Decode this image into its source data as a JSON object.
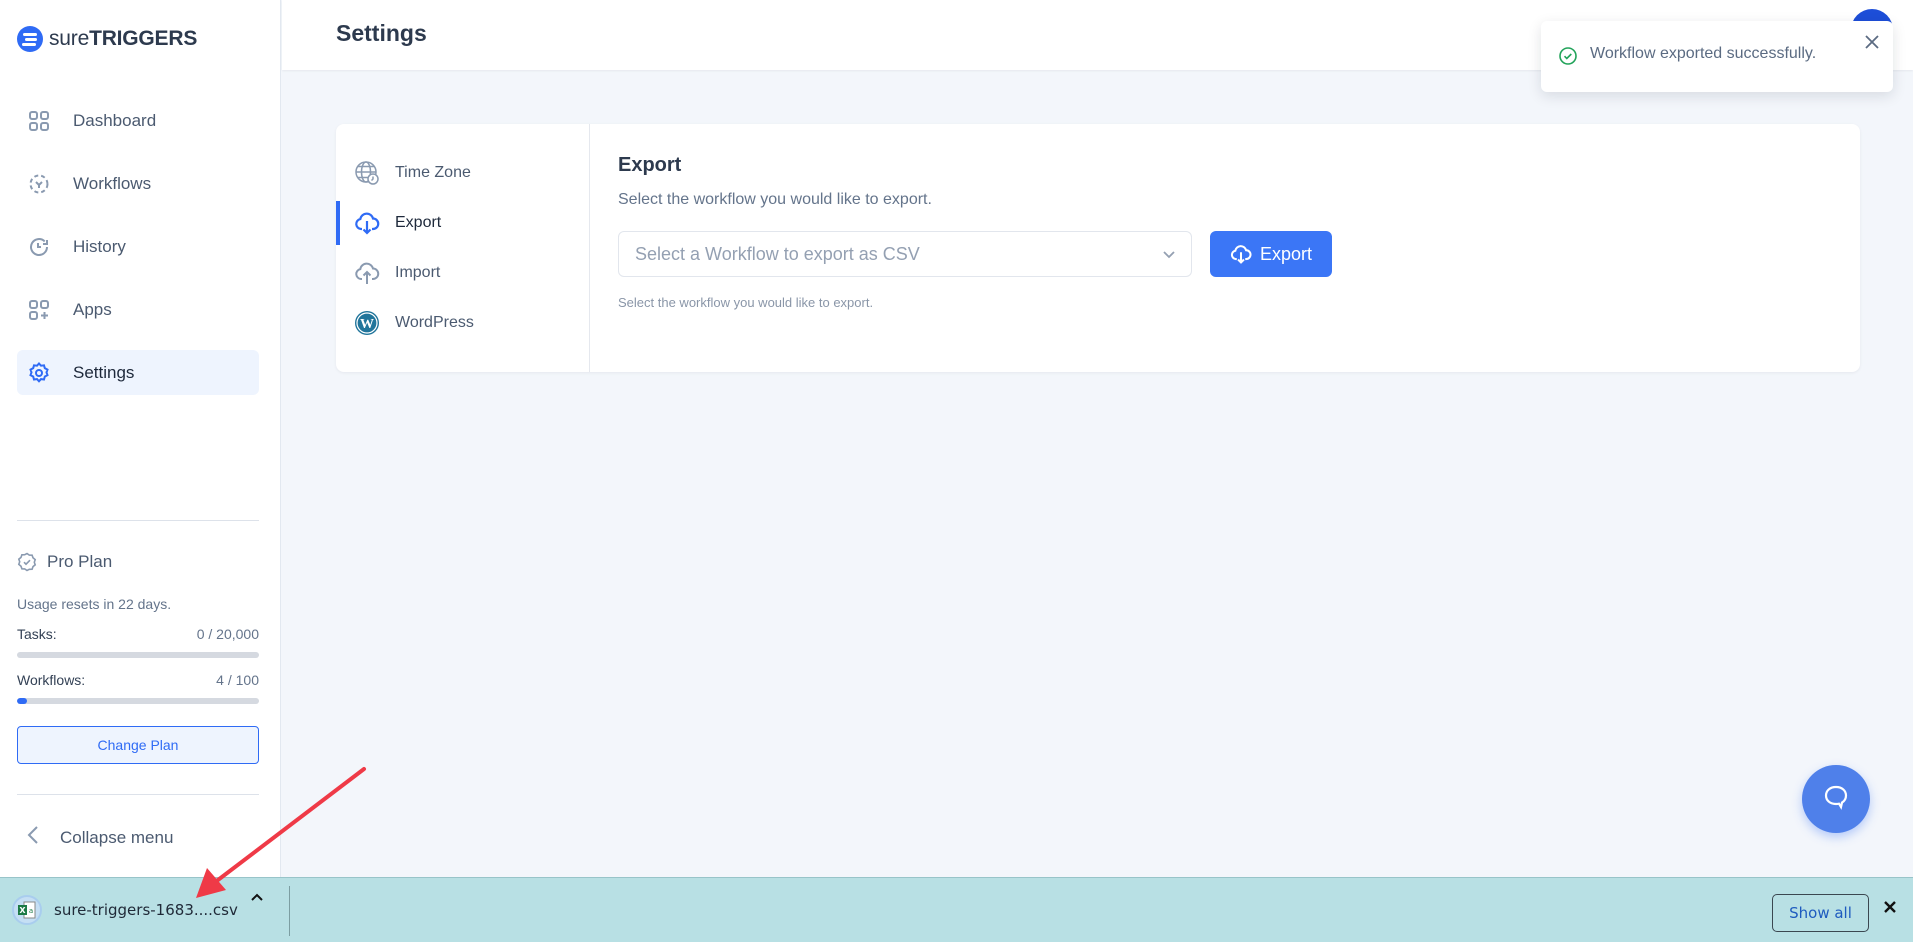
{
  "brand": {
    "name_light": "sure",
    "name_bold": "TRIGGERS"
  },
  "sidebar": {
    "items": [
      {
        "label": "Dashboard",
        "icon": "dashboard-icon",
        "active": false
      },
      {
        "label": "Workflows",
        "icon": "workflows-icon",
        "active": false
      },
      {
        "label": "History",
        "icon": "history-icon",
        "active": false
      },
      {
        "label": "Apps",
        "icon": "apps-icon",
        "active": false
      },
      {
        "label": "Settings",
        "icon": "gear-icon",
        "active": true
      }
    ],
    "plan": {
      "title": "Pro Plan",
      "reset_text": "Usage resets in 22 days.",
      "tasks_label": "Tasks:",
      "tasks_value": "0 / 20,000",
      "tasks_fraction": 0,
      "workflows_label": "Workflows:",
      "workflows_value": "4 / 100",
      "workflows_fraction": 0.04,
      "change_plan_label": "Change Plan"
    },
    "collapse_label": "Collapse menu"
  },
  "header": {
    "title": "Settings"
  },
  "settings_nav": [
    {
      "label": "Time Zone",
      "icon": "globe-clock-icon",
      "active": false
    },
    {
      "label": "Export",
      "icon": "cloud-download-icon",
      "active": true
    },
    {
      "label": "Import",
      "icon": "cloud-upload-icon",
      "active": false
    },
    {
      "label": "WordPress",
      "icon": "wordpress-icon",
      "active": false
    }
  ],
  "export_panel": {
    "title": "Export",
    "description": "Select the workflow you would like to export.",
    "select_placeholder": "Select a Workflow to export as CSV",
    "button_label": "Export",
    "hint": "Select the workflow you would like to export."
  },
  "toast": {
    "message": "Workflow exported successfully.",
    "status": "success"
  },
  "download_bar": {
    "file_name": "sure-triggers-1683....csv",
    "show_all_label": "Show all"
  },
  "colors": {
    "accent": "#2f6bf5",
    "success": "#22a35a",
    "download_bar_bg": "#b8e0e4",
    "annotation_arrow": "#ef3a47"
  }
}
